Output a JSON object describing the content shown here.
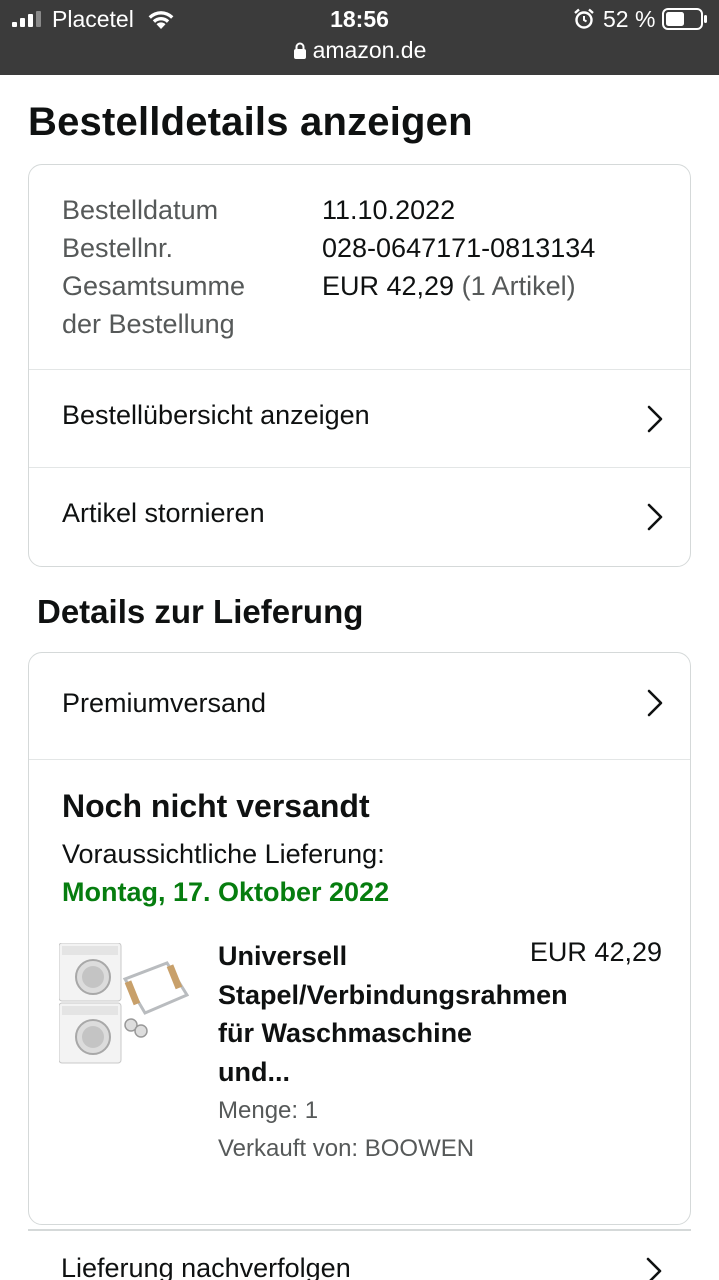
{
  "status_bar": {
    "carrier": "Placetel",
    "time": "18:56",
    "battery_percent": "52 %",
    "url": "amazon.de"
  },
  "page_title": "Bestelldetails anzeigen",
  "order_info": {
    "date_label": "Bestelldatum",
    "date_value": "11.10.2022",
    "number_label": "Bestellnr.",
    "number_value": "028-0647171-0813134",
    "total_label_line1": "Gesamtsumme",
    "total_label_line2": "der Bestellung",
    "total_value": "EUR 42,29",
    "total_items": "(1 Artikel)"
  },
  "order_links": {
    "overview": "Bestellübersicht anzeigen",
    "cancel": "Artikel stornieren"
  },
  "delivery": {
    "section_title": "Details zur Lieferung",
    "shipping_method": "Premiumversand",
    "status": "Noch nicht versandt",
    "eta_label": "Voraussichtliche Lieferung:",
    "eta_date": "Montag, 17. Oktober 2022",
    "item": {
      "title_line1": "Universell",
      "title_line2": "Stapel/Verbindungsrahmen",
      "title_line3": "für Waschmaschine",
      "title_line4": "und...",
      "price": "EUR 42,29",
      "quantity": "Menge: 1",
      "seller": "Verkauft von: BOOWEN"
    },
    "track_link": "Lieferung nachverfolgen"
  },
  "colors": {
    "status_bar_bg": "#3b3b3b",
    "eta_green": "#067d0f",
    "border": "#d5d9d9",
    "muted_text": "#565959"
  }
}
